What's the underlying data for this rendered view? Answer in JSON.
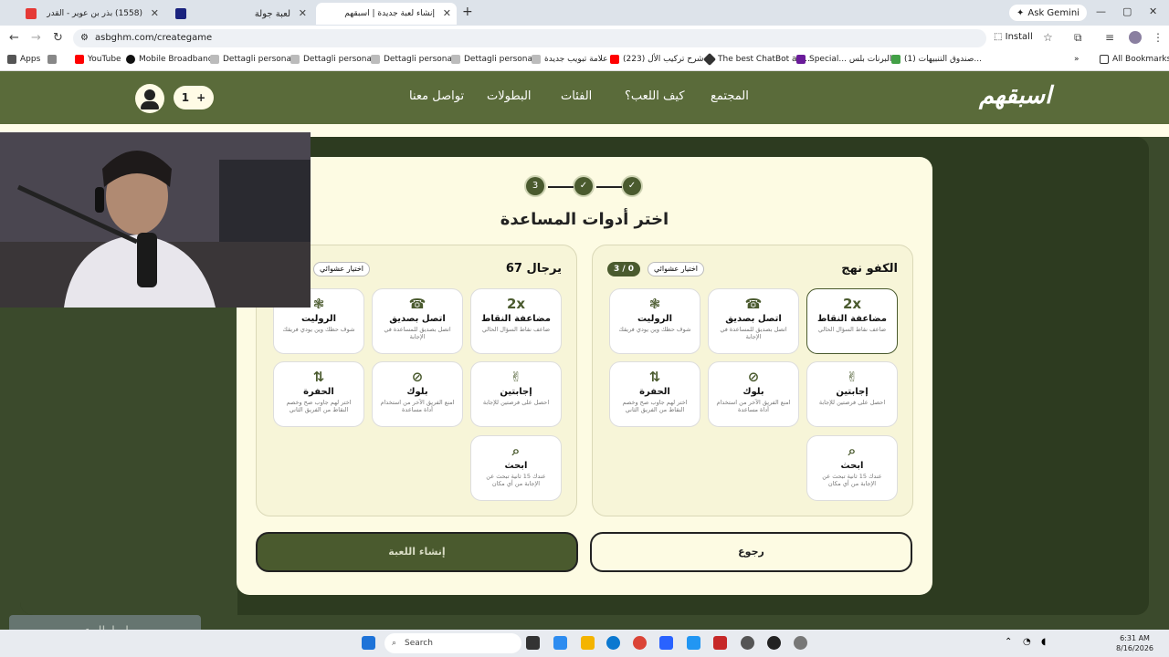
{
  "browser": {
    "tabs": [
      {
        "label": "(1558) بذر بن عوير - القدر",
        "color": "#e53935"
      },
      {
        "label": "لعبة جولة",
        "color": "#1a237e"
      },
      {
        "label": "إنشاء لعبة جديدة | اسبقهم",
        "color": "#fff"
      }
    ],
    "ask_gemini": "Ask Gemini",
    "url": "asbghm.com/creategame",
    "install": "Install",
    "bookmarks": [
      "Apps",
      "YouTube",
      "Mobile Broadband",
      "Dettagli personali",
      "Dettagli personali",
      "Dettagli personali",
      "Dettagli personali",
      "علامة تبويب جديدة",
      "(223) شرح تركيب الأل...",
      "The best ChatBot an...",
      "Special... البرنات بلس",
      "(1) صندوق التنبيهات...",
      "All Bookmarks"
    ],
    "bookmark_colors": [
      "#555",
      "#ff0000",
      "#111",
      "#999",
      "#999",
      "#999",
      "#999",
      "#999",
      "#ff0000",
      "#333",
      "#6a1b9a",
      "#43a047",
      "#333"
    ]
  },
  "site": {
    "logo": "اسبقهم",
    "menu": [
      "المجتمع",
      "كيف اللعب؟",
      "الفئات",
      "البطولات",
      "تواصل معنا"
    ],
    "counter": "1",
    "counter_plus": "+"
  },
  "steps": {
    "labels": [
      "✓",
      "✓",
      "3"
    ]
  },
  "page_title": "اختر أدوات المساعدة",
  "random_label": "اختيار عشوائي",
  "teams": [
    {
      "name": "الكفو نهج",
      "score": "3 / 0"
    },
    {
      "name": "يرجال 67",
      "score": ""
    }
  ],
  "tools": [
    {
      "icon": "2x",
      "title": "مضاعفة النقاط",
      "desc": "ضاعف نقاط السؤال الحالي"
    },
    {
      "icon": "☎",
      "title": "اتصل بصديق",
      "desc": "اتصل بصديق للمساعدة في الإجابة"
    },
    {
      "icon": "❃",
      "title": "الروليت",
      "desc": "شوف حظك وين يودي فريقك"
    },
    {
      "icon": "✌",
      "title": "إجابتين",
      "desc": "احصل على فرصتين للإجابة"
    },
    {
      "icon": "⊘",
      "title": "بلوك",
      "desc": "امنع الفريق الآخر من استخدام أداة مساعدة"
    },
    {
      "icon": "⇅",
      "title": "الحفرة",
      "desc": "اختر لهم جاوب صح وخصم النقاط من الفريق الثاني"
    },
    {
      "icon": "⌕",
      "title": "ابحث",
      "desc": "عندك 15 ثانية تبحث عن الإجابة من أي مكان"
    }
  ],
  "buttons": {
    "back": "رجوع",
    "create": "إنشاء اللعبة"
  },
  "taskbar": {
    "search": "Search",
    "time": "6:31 AM",
    "date": "8/16/2026"
  },
  "promo": "رابط الدعم"
}
